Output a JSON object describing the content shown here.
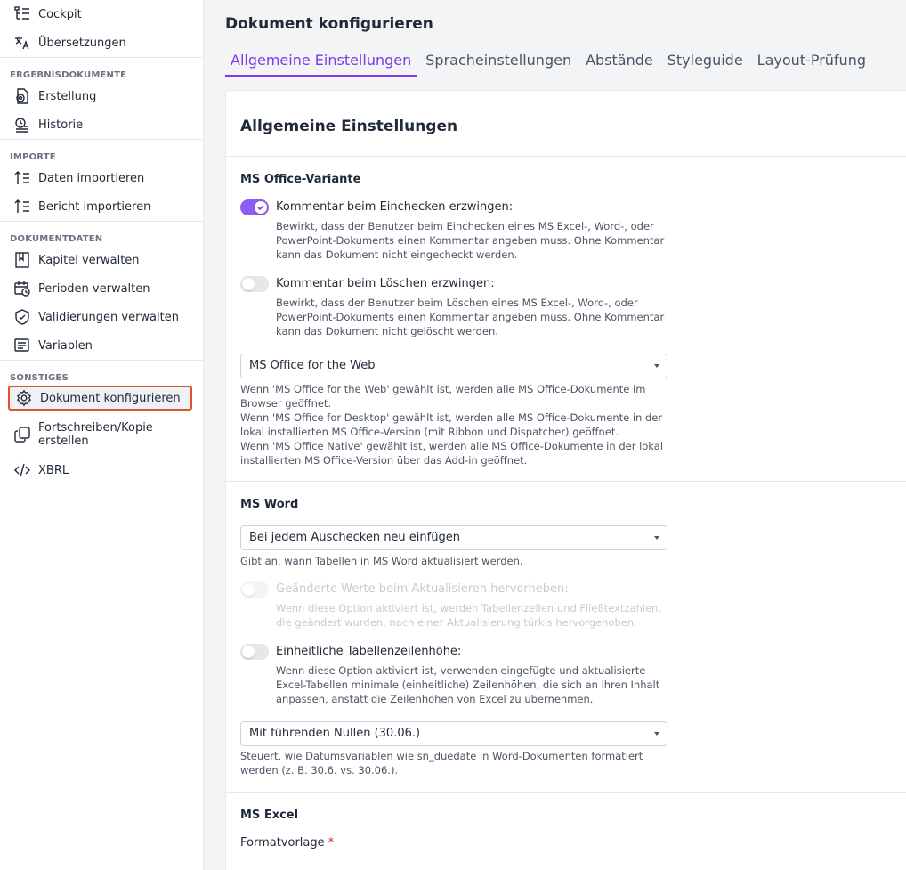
{
  "sidebar": {
    "top_items": [
      {
        "label": "Cockpit",
        "icon": "tree-icon"
      },
      {
        "label": "Übersetzungen",
        "icon": "translate-icon"
      }
    ],
    "sections": [
      {
        "title": "ERGEBNISDOKUMENTE",
        "items": [
          {
            "label": "Erstellung",
            "icon": "document-gear-icon"
          },
          {
            "label": "Historie",
            "icon": "history-icon"
          }
        ]
      },
      {
        "title": "IMPORTE",
        "items": [
          {
            "label": "Daten importieren",
            "icon": "import-list-icon"
          },
          {
            "label": "Bericht importieren",
            "icon": "import-list-icon"
          }
        ]
      },
      {
        "title": "DOKUMENTDATEN",
        "items": [
          {
            "label": "Kapitel verwalten",
            "icon": "bookmark-icon"
          },
          {
            "label": "Perioden verwalten",
            "icon": "calendar-clock-icon"
          },
          {
            "label": "Validierungen verwalten",
            "icon": "shield-check-icon"
          },
          {
            "label": "Variablen",
            "icon": "variable-list-icon"
          }
        ]
      },
      {
        "title": "SONSTIGES",
        "items": [
          {
            "label": "Dokument konfigurieren",
            "icon": "gear-icon"
          },
          {
            "label": "Fortschreiben/Kopie erstellen",
            "icon": "copy-icon"
          },
          {
            "label": "XBRL",
            "icon": "code-icon"
          }
        ]
      }
    ]
  },
  "main": {
    "title": "Dokument konfigurieren",
    "tabs": [
      "Allgemeine Einstellungen",
      "Spracheinstellungen",
      "Abstände",
      "Styleguide",
      "Layout-Prüfung"
    ],
    "active_tab": 0
  },
  "card": {
    "title": "Allgemeine Einstellungen",
    "office": {
      "heading": "MS Office-Variante",
      "toggle1_label": "Kommentar beim Einchecken erzwingen:",
      "toggle1_desc": "Bewirkt, dass der Benutzer beim Einchecken eines MS Excel-, Word-, oder PowerPoint-Dokuments einen Kommentar angeben muss. Ohne Kommentar kann das Dokument nicht eingecheckt werden.",
      "toggle2_label": "Kommentar beim Löschen erzwingen:",
      "toggle2_desc": "Bewirkt, dass der Benutzer beim Löschen eines MS Excel-, Word-, oder PowerPoint-Dokuments einen Kommentar angeben muss. Ohne Kommentar kann das Dokument nicht gelöscht werden.",
      "select_value": "MS Office for the Web",
      "help_line1": "Wenn 'MS Office for the Web' gewählt ist, werden alle MS Office-Dokumente im Browser geöffnet.",
      "help_line2": "Wenn 'MS Office for Desktop' gewählt ist, werden alle MS Office-Dokumente in der lokal installierten MS Office-Version (mit Ribbon und Dispatcher) geöffnet.",
      "help_line3": "Wenn 'MS Office Native' gewählt ist, werden alle MS Office-Dokumente in der lokal installierten MS Office-Version über das Add-in geöffnet."
    },
    "word": {
      "heading": "MS Word",
      "select1_value": "Bei jedem Auschecken neu einfügen",
      "select1_help": "Gibt an, wann Tabellen in MS Word aktualisiert werden.",
      "toggle1_label": "Geänderte Werte beim Aktualisieren hervorheben:",
      "toggle1_desc": "Wenn diese Option aktiviert ist, werden Tabellenzellen und Fließtextzahlen, die geändert wurden, nach einer Aktualisierung türkis hervorgehoben.",
      "toggle2_label": "Einheitliche Tabellenzeilenhöhe:",
      "toggle2_desc": "Wenn diese Option aktiviert ist, verwenden eingefügte und aktualisierte Excel-Tabellen minimale (einheitliche) Zeilenhöhen, die sich an ihren Inhalt anpassen, anstatt die Zeilenhöhen von Excel zu übernehmen.",
      "select2_value": "Mit führenden Nullen (30.06.)",
      "select2_help": "Steuert, wie Datumsvariablen wie sn_duedate in Word-Dokumenten formatiert werden (z. B. 30.6. vs. 30.06.)."
    },
    "excel": {
      "heading": "MS Excel",
      "format_label": "Formatvorlage",
      "required_mark": "*"
    }
  },
  "colors": {
    "accent": "#7c3aed",
    "toggle_on": "#8b5cf6",
    "highlight_border": "#e0532f"
  }
}
